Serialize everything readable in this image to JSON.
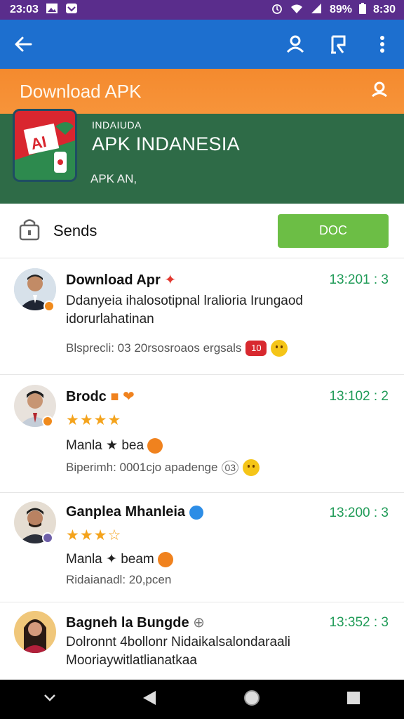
{
  "status_bar": {
    "time_left": "23:03",
    "battery": "89%",
    "time_right": "8:30"
  },
  "banner": {
    "title": "Download APK"
  },
  "app": {
    "small_label": "INDAIUDA",
    "name": "APK INDANESIA",
    "subtitle": "APK AN,"
  },
  "section": {
    "label": "Sends",
    "button_label": "DOC"
  },
  "feed": [
    {
      "title": "Download Apr",
      "time": "13:201 : 3",
      "body": "Ddanyeia ihalosotipnal lralioria Irungaod idorurlahatinan",
      "meta": "Blsprecli: 03 20rsosroaos ergsals",
      "tag": "10"
    },
    {
      "title": "Brodc",
      "time": "13:102 : 2",
      "rating": "★★★★",
      "body": "Manla ★ bea",
      "meta": "Biperimh: 0001cjo apadenge",
      "tag": "03"
    },
    {
      "title": "Ganplea Mhanleia",
      "time": "13:200 : 3",
      "rating": "★★★☆",
      "body": "Manla ✦ beam",
      "meta": "Ridaianadl: 20,pcen"
    },
    {
      "title": "Bagneh la Bungde",
      "time": "13:352 : 3",
      "body": "Dolronnt 4bollonr Nidaikalsalondaraali Mooriaywitlatlianatkaa"
    }
  ],
  "colors": {
    "status_bar": "#5a2d8c",
    "app_bar": "#1d6fcf",
    "banner_orange": "#f48a2e",
    "banner_green": "#2e6b47",
    "doc_button": "#6cbe45",
    "timestamp": "#1f9b57",
    "stars": "#f4a31c"
  },
  "icons": {
    "app_bar": [
      "back-arrow-icon",
      "person-icon",
      "person-card-icon",
      "more-vert-icon"
    ],
    "nav_bar": [
      "chevron-down-icon",
      "back-triangle-icon",
      "home-circle-icon",
      "recents-square-icon"
    ]
  }
}
